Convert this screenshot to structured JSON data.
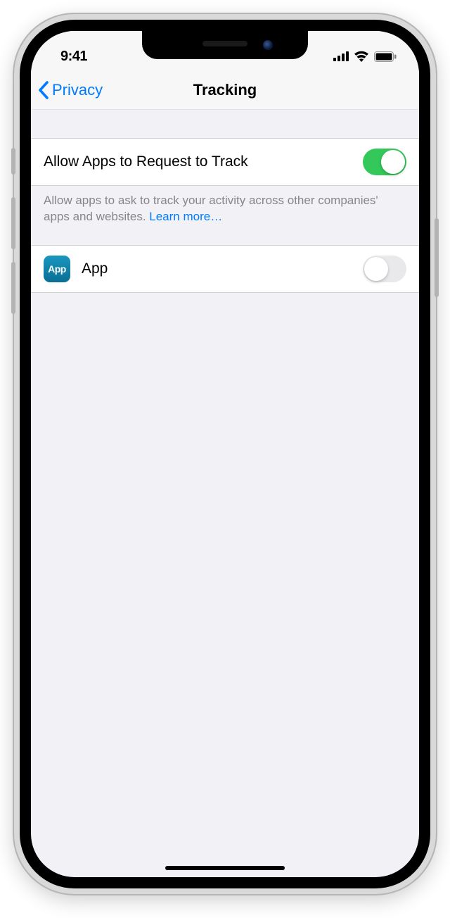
{
  "statusBar": {
    "time": "9:41"
  },
  "nav": {
    "backLabel": "Privacy",
    "title": "Tracking"
  },
  "settings": {
    "allowRequest": {
      "label": "Allow Apps to Request to Track",
      "enabled": true,
      "description": "Allow apps to ask to track your activity across other companies' apps and websites. ",
      "learnMore": "Learn more…"
    },
    "apps": [
      {
        "name": "App",
        "iconText": "App",
        "enabled": false
      }
    ]
  }
}
